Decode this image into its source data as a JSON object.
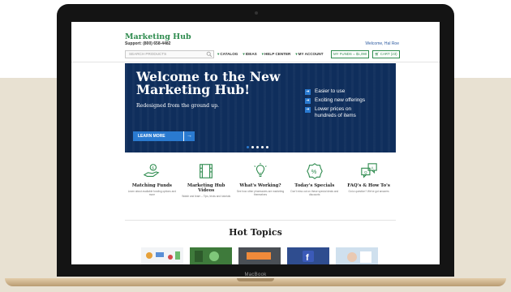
{
  "device": {
    "label": "MacBook"
  },
  "header": {
    "logo": "Marketing Hub",
    "support": "Support: (800) 658-4482",
    "welcome": "Welcome, Hal Roe",
    "search_placeholder": "SEARCH PRODUCTS",
    "nav": [
      "CATALOG",
      "IDEAS",
      "HELP CENTER",
      "MY ACCOUNT"
    ],
    "funds": "MY FUNDS = $1,090",
    "cart": "CART (23)"
  },
  "hero": {
    "title": "Welcome to the New Marketing Hub!",
    "subtitle": "Redesigned from the ground up.",
    "button": "LEARN MORE",
    "bullets": [
      "Easier to use",
      "Exciting new offerings",
      "Lower prices on hundreds of items"
    ],
    "carousel_slides": 5,
    "carousel_active": 0
  },
  "features": [
    {
      "icon": "money-hand-icon",
      "title": "Matching Funds",
      "desc": "Learn about available funding options and more"
    },
    {
      "icon": "film-strip-icon",
      "title": "Marketing Hub Videos",
      "desc": "Watch and learn – Tips, tricks and tutorials"
    },
    {
      "icon": "lightbulb-icon",
      "title": "What's Working?",
      "desc": "See how other pharmacies are marketing themselves"
    },
    {
      "icon": "percent-badge-icon",
      "title": "Today's Specials",
      "desc": "Don't miss out on these special deals and discounts"
    },
    {
      "icon": "chat-bubbles-icon",
      "title": "FAQ's & How To's",
      "desc": "Got a question? We've got answers"
    }
  ],
  "hot_topics": {
    "title": "Hot Topics"
  },
  "colors": {
    "brand_green": "#2e8b4e",
    "hero_navy": "#0f2e5c",
    "accent_blue": "#2a7ad0"
  }
}
